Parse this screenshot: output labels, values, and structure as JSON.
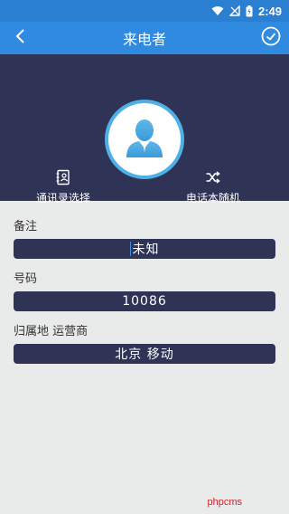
{
  "status_bar": {
    "time": "2:49",
    "icons": [
      "wifi-icon",
      "signal-icon",
      "battery-icon"
    ]
  },
  "app_bar": {
    "title": "来电者",
    "back_icon": "chevron-left-icon",
    "confirm_icon": "check-circle-icon"
  },
  "hero": {
    "avatar_icon": "person-avatar-icon",
    "contacts_label": "通讯录选择",
    "contacts_icon": "contacts-book-icon",
    "random_label": "电话本随机",
    "random_icon": "shuffle-icon"
  },
  "form": {
    "note_label": "备注",
    "note_value": "未知",
    "number_label": "号码",
    "number_value": "10086",
    "carrier_label": "归属地 运营商",
    "carrier_value": "北京 移动"
  },
  "watermark": "phpcms",
  "colors": {
    "status_bar": "#2a7fd0",
    "app_bar": "#2f8ae0",
    "hero_bg": "#2f3456",
    "page_bg": "#e9eaea",
    "accent": "#4fb0e8"
  }
}
